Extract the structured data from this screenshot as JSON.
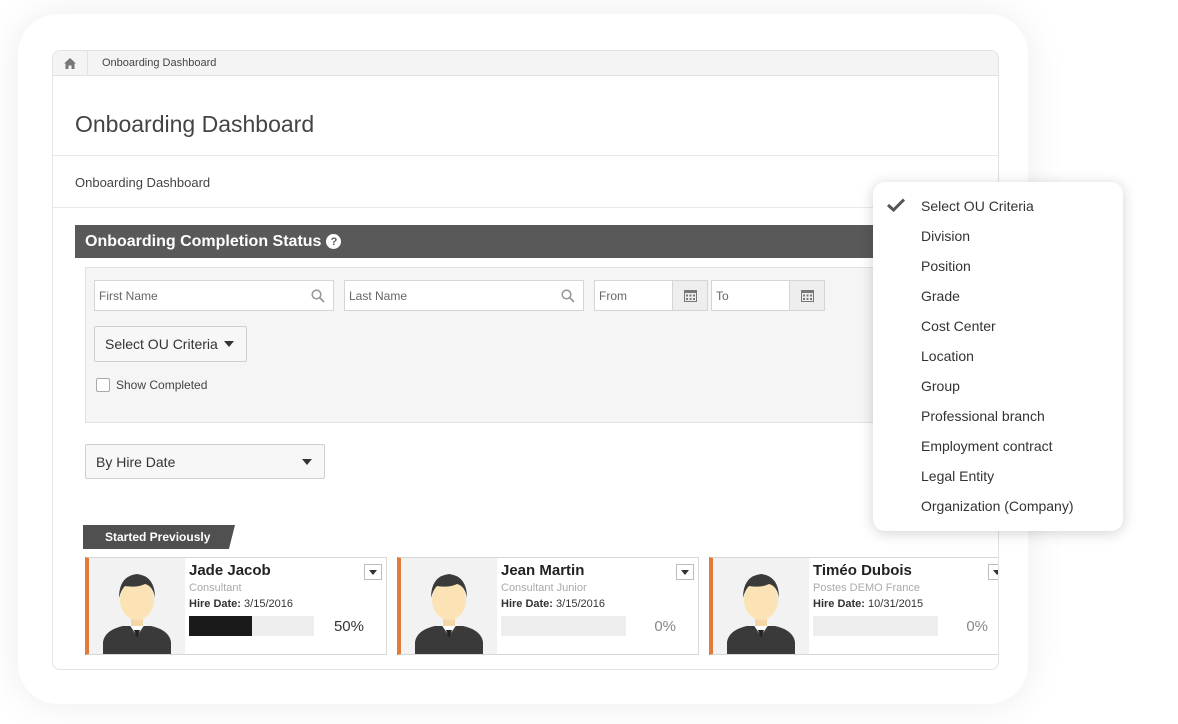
{
  "breadcrumb": {
    "current": "Onboarding Dashboard"
  },
  "page": {
    "title": "Onboarding Dashboard",
    "subtitle": "Onboarding Dashboard"
  },
  "section": {
    "title": "Onboarding Completion Status",
    "help": "?"
  },
  "filters": {
    "first_name_placeholder": "First Name",
    "last_name_placeholder": "Last Name",
    "from_placeholder": "From",
    "to_placeholder": "To",
    "ou_button": "Select OU Criteria",
    "show_completed": "Show Completed"
  },
  "sort": {
    "selected": "By Hire Date"
  },
  "group": {
    "label": "Started Previously"
  },
  "cards": [
    {
      "name": "Jade Jacob",
      "role": "Consultant",
      "hire_label": "Hire Date:",
      "hire_date": "3/15/2016",
      "percent_text": "50%",
      "progress": 0.5,
      "accent": "#e07b39"
    },
    {
      "name": "Jean Martin",
      "role": "Consultant Junior",
      "hire_label": "Hire Date:",
      "hire_date": "3/15/2016",
      "percent_text": "0%",
      "progress": 0,
      "accent": "#e07b39"
    },
    {
      "name": "Timéo Dubois",
      "role": "Postes DEMO France",
      "hire_label": "Hire Date:",
      "hire_date": "10/31/2015",
      "percent_text": "0%",
      "progress": 0,
      "accent": "#e07b39"
    }
  ],
  "ou_menu": {
    "items": [
      {
        "label": "Select OU Criteria",
        "checked": true
      },
      {
        "label": "Division",
        "checked": false
      },
      {
        "label": "Position",
        "checked": false
      },
      {
        "label": "Grade",
        "checked": false
      },
      {
        "label": "Cost Center",
        "checked": false
      },
      {
        "label": "Location",
        "checked": false
      },
      {
        "label": "Group",
        "checked": false
      },
      {
        "label": "Professional branch",
        "checked": false
      },
      {
        "label": "Employment contract",
        "checked": false
      },
      {
        "label": "Legal Entity",
        "checked": false
      },
      {
        "label": "Organization (Company)",
        "checked": false
      }
    ]
  },
  "icons": [
    "home-icon",
    "search-icon",
    "calendar-icon",
    "help-icon",
    "chevron-down-icon",
    "check-icon",
    "avatar-icon"
  ]
}
